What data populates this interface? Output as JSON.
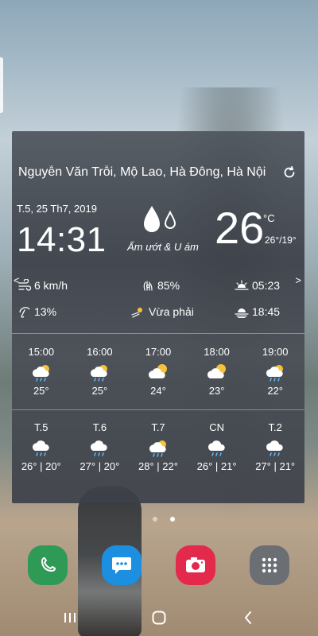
{
  "location": "Nguyễn Văn Trỗi, Mộ Lao, Hà Đông, Hà Nội",
  "date": "T.5, 25 Th7, 2019",
  "time": "14:31",
  "condition": "Ẩm ướt & U ám",
  "temperature": "26",
  "temperature_unit": "°C",
  "temp_range": "26°/19°",
  "stats": {
    "wind": "6 km/h",
    "humidity": "85%",
    "sunrise": "05:23",
    "precipitation": "13%",
    "uv": "Vừa phải",
    "sunset": "18:45"
  },
  "hourly": [
    {
      "time": "15:00",
      "temp": "25°",
      "icon": "cloud-sun-rain-icon"
    },
    {
      "time": "16:00",
      "temp": "25°",
      "icon": "cloud-sun-rain-icon"
    },
    {
      "time": "17:00",
      "temp": "24°",
      "icon": "sun-cloud-icon"
    },
    {
      "time": "18:00",
      "temp": "23°",
      "icon": "sun-cloud-icon"
    },
    {
      "time": "19:00",
      "temp": "22°",
      "icon": "cloud-sun-rain-icon"
    }
  ],
  "daily": [
    {
      "day": "T.5",
      "range": "26° | 20°",
      "icon": "cloud-rain-icon"
    },
    {
      "day": "T.6",
      "range": "27° | 20°",
      "icon": "cloud-rain-icon"
    },
    {
      "day": "T.7",
      "range": "28° | 22°",
      "icon": "cloud-sun-rain-icon"
    },
    {
      "day": "CN",
      "range": "26° | 21°",
      "icon": "cloud-rain-icon"
    },
    {
      "day": "T.2",
      "range": "27° | 21°",
      "icon": "cloud-rain-icon"
    }
  ],
  "nav": {
    "left": "<",
    "right": ">"
  },
  "colors": {
    "sun": "#f5c23a",
    "rain": "#5bb6f0",
    "phone": "#2e9a56",
    "messages": "#1c8fe0",
    "camera": "#e32a4c",
    "apps": "#6b6e73"
  }
}
